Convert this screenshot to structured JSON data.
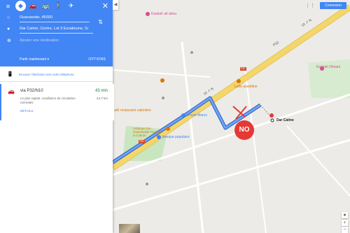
{
  "panel": {
    "close_symbol": "✕",
    "modes": [
      {
        "icon": "menu-icon",
        "glyph": "≡"
      },
      {
        "icon": "directions-icon",
        "glyph": "◆",
        "active": true
      },
      {
        "icon": "car-icon",
        "glyph": "🚗"
      },
      {
        "icon": "transit-icon",
        "glyph": "🚌"
      },
      {
        "icon": "walk-icon",
        "glyph": "🚶"
      },
      {
        "icon": "flight-icon",
        "glyph": "✈"
      }
    ],
    "origin": "Ouarzazate, 45000",
    "destination": "Dar Calme, Centre, Lot 3 Ezzaitoune, Si",
    "add_destination": "Ajouter une destination",
    "depart": "Partir maintenant",
    "options": "OPTIONS",
    "send_phone": "Envoyer l'itinéraire vers votre téléphone",
    "route": {
      "via": "via P32/N10",
      "time": "43 min",
      "distance": "44,7 km",
      "desc": "Le plus rapide, conditions de circulation normales",
      "details": "DÉTAILS"
    }
  },
  "topbar": {
    "signin": "Connexion"
  },
  "map": {
    "labels": [
      {
        "text": "Kasbah ait abou",
        "color": "#d94e8f"
      },
      {
        "text": "Kasbah Dimani",
        "color": "#d94e8f"
      },
      {
        "text": "Caffe azeddine",
        "color": "#d97706"
      },
      {
        "text": "Poste Maroc",
        "color": "#4285f4"
      },
      {
        "text": "banque populaire",
        "color": "#4285f4"
      },
      {
        "text": "café restaurant valentine",
        "color": "#d97706"
      },
      {
        "text": "Auberge Dar Ouarzazate Tourisme & Culture",
        "color": "#d97706"
      },
      {
        "text": "Dar Calme",
        "color": "#222222"
      }
    ],
    "road_labels": [
      "P32",
      "10 ↗ N",
      "10 ↗ N",
      "P32",
      "P32"
    ],
    "overlay_text": "NO",
    "colors": {
      "road": "#f5d66b",
      "route": "#4285f4",
      "route_outline": "#2a5fbf",
      "no_cross": "#e53935",
      "header": "#4285f4"
    }
  },
  "zoom": {
    "plus": "+",
    "minus": "−"
  },
  "footer_icon": "pegman-icon"
}
